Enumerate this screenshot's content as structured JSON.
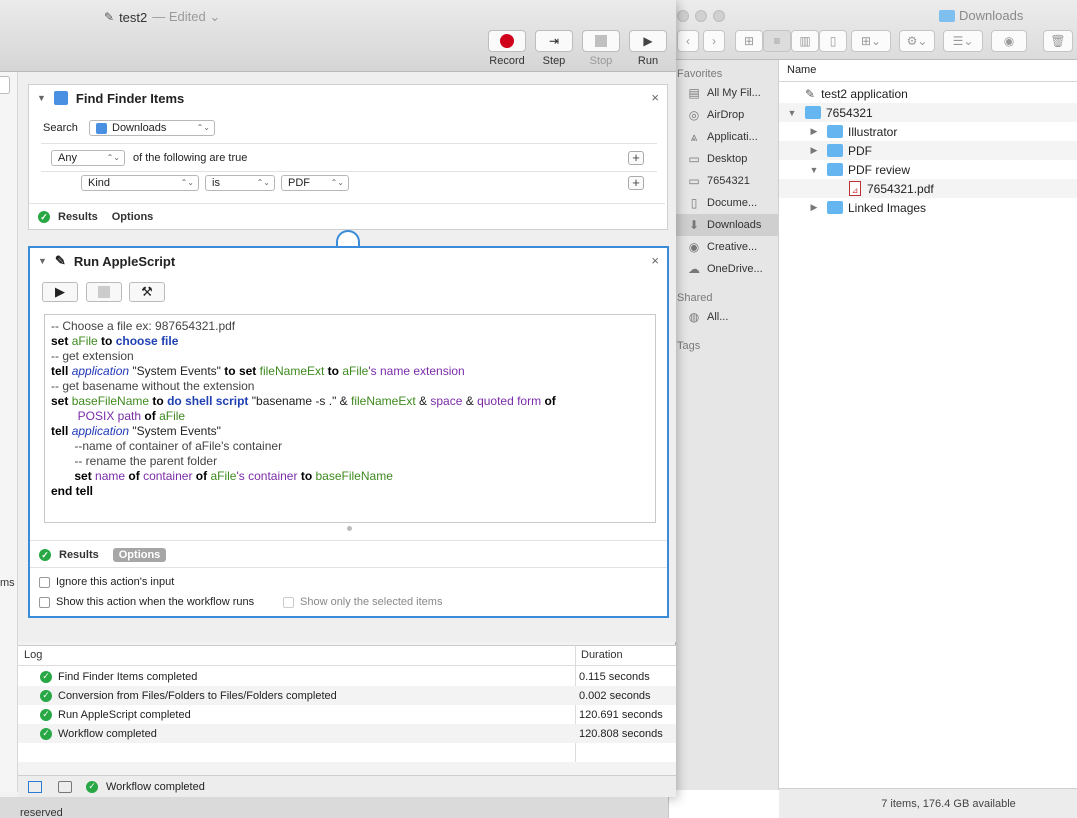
{
  "finder": {
    "title": "Downloads",
    "sidebar": {
      "favorites_label": "Favorites",
      "items": [
        {
          "label": "All My Fil...",
          "icon": "all-files-icon",
          "glyph": "▤"
        },
        {
          "label": "AirDrop",
          "icon": "airdrop-icon",
          "glyph": "◎"
        },
        {
          "label": "Applicati...",
          "icon": "applications-icon",
          "glyph": "⩓"
        },
        {
          "label": "Desktop",
          "icon": "desktop-icon",
          "glyph": "▭"
        },
        {
          "label": "7654321",
          "icon": "folder-icon",
          "glyph": "▭"
        },
        {
          "label": "Docume...",
          "icon": "documents-icon",
          "glyph": "▯"
        },
        {
          "label": "Downloads",
          "icon": "downloads-icon",
          "glyph": "⬇"
        },
        {
          "label": "Creative...",
          "icon": "creative-cloud-icon",
          "glyph": "◉"
        },
        {
          "label": "OneDrive...",
          "icon": "cloud-icon",
          "glyph": "☁"
        }
      ],
      "shared_label": "Shared",
      "shared_items": [
        {
          "label": "All...",
          "icon": "network-icon",
          "glyph": "◍"
        }
      ],
      "tags_label": "Tags"
    },
    "list_header": "Name",
    "rows": [
      {
        "label": "test2 application",
        "type": "app",
        "depth": 0,
        "disclosure": ""
      },
      {
        "label": "7654321",
        "type": "folder",
        "depth": 0,
        "disclosure": "▼"
      },
      {
        "label": "Illustrator",
        "type": "folder",
        "depth": 1,
        "disclosure": "▶"
      },
      {
        "label": "PDF",
        "type": "folder",
        "depth": 1,
        "disclosure": "▶"
      },
      {
        "label": "PDF review",
        "type": "folder",
        "depth": 1,
        "disclosure": "▼"
      },
      {
        "label": "7654321.pdf",
        "type": "pdf",
        "depth": 2,
        "disclosure": ""
      },
      {
        "label": "Linked Images",
        "type": "folder",
        "depth": 1,
        "disclosure": "▶"
      }
    ],
    "status": "7 items, 176.4 GB available"
  },
  "automator": {
    "title": "test2",
    "edited": "— Edited ⌄",
    "toolbar": {
      "record": "Record",
      "step": "Step",
      "stop": "Stop",
      "run": "Run"
    },
    "find_action": {
      "title": "Find Finder Items",
      "search_label": "Search",
      "search_location": "Downloads",
      "any_value": "Any",
      "of_following": "of the following are true",
      "kind_value": "Kind",
      "is_value": "is",
      "pdf_value": "PDF",
      "results": "Results",
      "options": "Options"
    },
    "script_action": {
      "title": "Run AppleScript",
      "results": "Results",
      "options": "Options",
      "ignore_input": "Ignore this action's input",
      "show_when_runs": "Show this action when the workflow runs",
      "show_selected": "Show only the selected items"
    },
    "left_cut_text": "ms",
    "log": {
      "col_log": "Log",
      "col_duration": "Duration",
      "rows": [
        {
          "message": "Find Finder Items completed",
          "duration": "0.115 seconds"
        },
        {
          "message": "Conversion from Files/Folders to Files/Folders completed",
          "duration": "0.002 seconds"
        },
        {
          "message": "Run AppleScript completed",
          "duration": "120.691 seconds"
        },
        {
          "message": "Workflow completed",
          "duration": "120.808 seconds"
        }
      ]
    },
    "status": "Workflow completed"
  },
  "below_text": "reserved",
  "colors": {
    "accent": "#3a8bd8",
    "record": "#d0021b",
    "success": "#28a745"
  }
}
